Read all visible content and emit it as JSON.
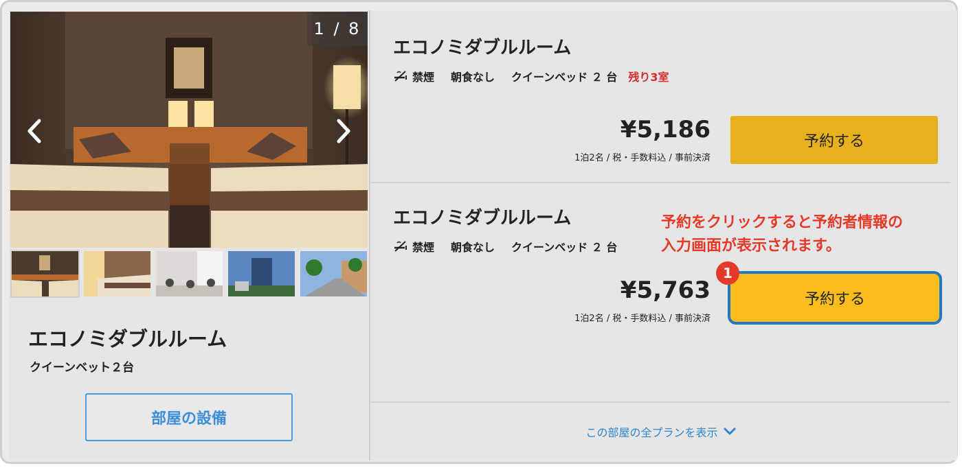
{
  "gallery": {
    "counter": "1 / 8",
    "prev_icon": "chevron-left-icon",
    "next_icon": "chevron-right-icon",
    "thumbnails": [
      "room-twin",
      "room-twin-2",
      "lobby",
      "hotel-exterior",
      "street-view"
    ]
  },
  "room": {
    "name": "エコノミダブルルーム",
    "bed": "クイーンベット２台",
    "amenities_label": "部屋の設備"
  },
  "plans": [
    {
      "title": "エコノミダブルルーム",
      "smoking": "禁煙",
      "meal": "朝食なし",
      "bed": "クイーンベッド ２ 台",
      "rooms_left": "残り3室",
      "price": "¥5,186",
      "price_note": "1泊2名 / 税・手数料込 / 事前決済",
      "reserve_label": "予約する"
    },
    {
      "title": "エコノミダブルルーム",
      "smoking": "禁煙",
      "meal": "朝食なし",
      "bed": "クイーンベッド ２ 台",
      "price": "¥5,763",
      "price_note": "1泊2名 / 税・手数料込 / 事前決済",
      "reserve_label": "予約する"
    }
  ],
  "annotation": {
    "line1": "予約をクリックすると予約者情報の",
    "line2": "入力画面が表示されます。",
    "step": "1"
  },
  "show_all_label": "この部屋の全プランを表示",
  "colors": {
    "reserve_button": "#e8b01b",
    "highlight_border": "#1f78c8",
    "annotation_red": "#e53929",
    "link_blue": "#2e86d0",
    "rooms_left_red": "#d92b2b"
  }
}
